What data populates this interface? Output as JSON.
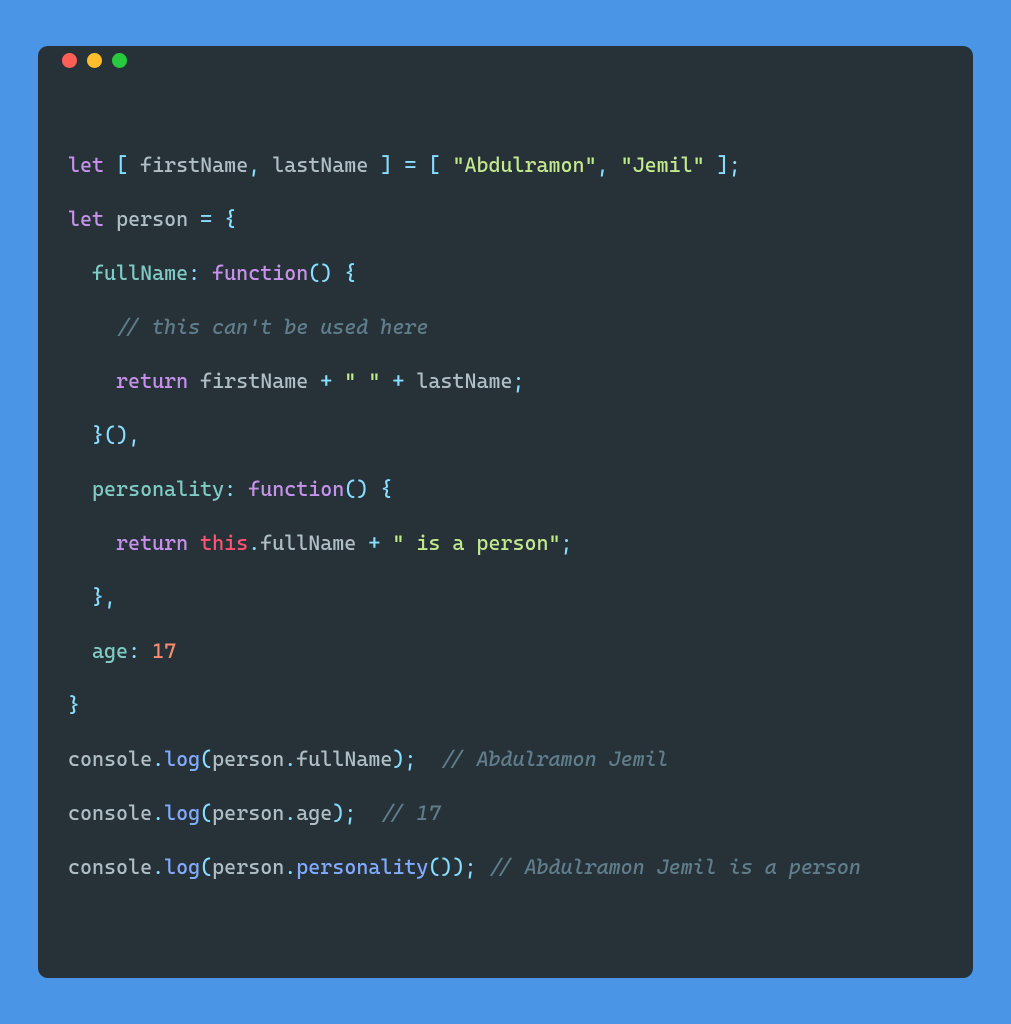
{
  "window": {
    "dot_colors": {
      "red": "#ff5f56",
      "yellow": "#ffbd2e",
      "green": "#27c93f"
    }
  },
  "code": {
    "l1": {
      "let": "let",
      "lb": " [ ",
      "v1": "firstName",
      "c1": ", ",
      "v2": "lastName",
      "rb": " ] ",
      "eq": "= ",
      "lb2": "[ ",
      "s1": "\"Abdulramon\"",
      "c2": ", ",
      "s2": "\"Jemil\"",
      "rb2": " ]",
      "semi": ";"
    },
    "l2": {
      "let": "let",
      "sp": " ",
      "name": "person",
      "sp2": " ",
      "eq": "= ",
      "lb": "{"
    },
    "l3": {
      "indent": "  ",
      "prop": "fullName",
      "colon": ": ",
      "fn": "function",
      "paren": "()",
      "sp": " ",
      "lb": "{"
    },
    "l4": {
      "indent": "    ",
      "cmt": "// this can't be used here"
    },
    "l5": {
      "indent": "    ",
      "ret": "return",
      "sp": " ",
      "v1": "firstName",
      "sp2": " ",
      "op1": "+",
      "sp3": " ",
      "s1": "\" \"",
      "sp4": " ",
      "op2": "+",
      "sp5": " ",
      "v2": "lastName",
      "semi": ";"
    },
    "l6": {
      "indent": "  ",
      "rb": "}()",
      "c": ","
    },
    "l7": {
      "indent": "  ",
      "prop": "personality",
      "colon": ": ",
      "fn": "function",
      "paren": "()",
      "sp": " ",
      "lb": "{"
    },
    "l8": {
      "indent": "    ",
      "ret": "return",
      "sp": " ",
      "this": "this",
      "dot": ".",
      "prop": "fullName",
      "sp2": " ",
      "op": "+",
      "sp3": " ",
      "s1": "\" is a person\"",
      "semi": ";"
    },
    "l9": {
      "indent": "  ",
      "rb": "}",
      "c": ","
    },
    "l10": {
      "indent": "  ",
      "prop": "age",
      "colon": ": ",
      "num": "17"
    },
    "l11": {
      "rb": "}"
    },
    "l12": {
      "obj": "console",
      "dot": ".",
      "fn": "log",
      "lp": "(",
      "arg1": "person",
      "dot2": ".",
      "prop": "fullName",
      "rp": ")",
      "semi": ";",
      "sp": "  ",
      "cmt": "// Abdulramon Jemil"
    },
    "l13": {
      "obj": "console",
      "dot": ".",
      "fn": "log",
      "lp": "(",
      "arg1": "person",
      "dot2": ".",
      "prop": "age",
      "rp": ")",
      "semi": ";",
      "sp": "  ",
      "cmt": "// 17"
    },
    "l14": {
      "obj": "console",
      "dot": ".",
      "fn": "log",
      "lp": "(",
      "arg1": "person",
      "dot2": ".",
      "fn2": "personality",
      "call": "()",
      "rp": ")",
      "semi": ";",
      "sp": " ",
      "cmt": "// Abdulramon Jemil is a person"
    }
  }
}
